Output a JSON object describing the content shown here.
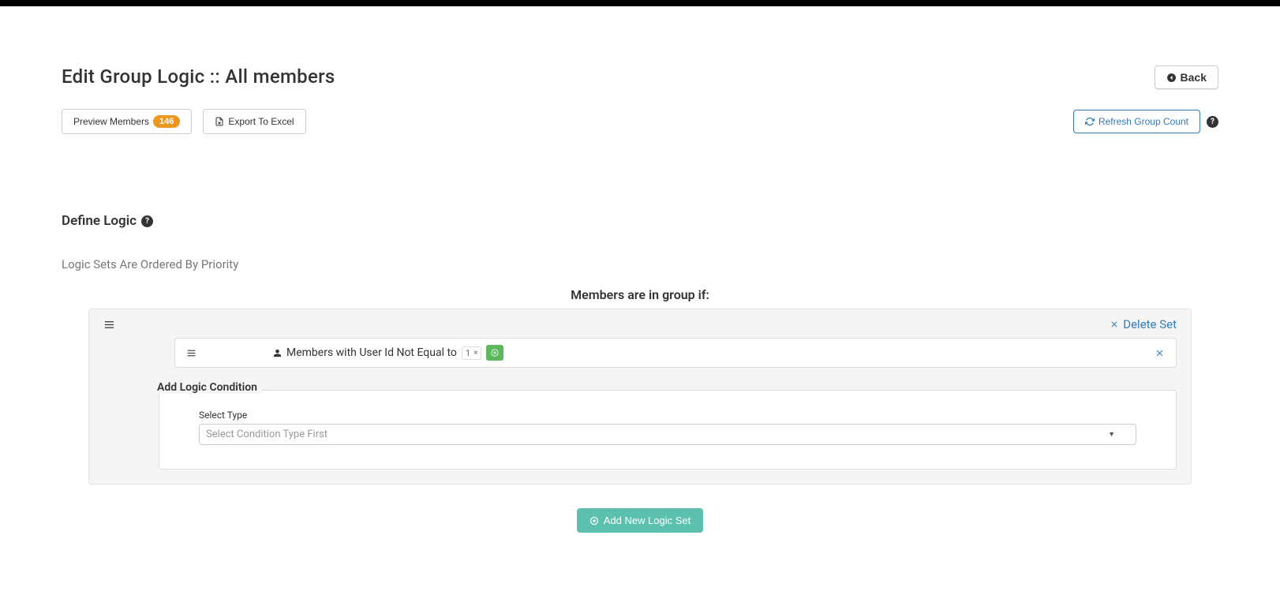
{
  "header": {
    "title": "Edit Group Logic :: All members",
    "back_label": "Back"
  },
  "actions": {
    "preview_label": "Preview Members",
    "preview_count": "146",
    "export_label": "Export To Excel",
    "refresh_label": "Refresh Group Count"
  },
  "define": {
    "title": "Define Logic",
    "priority_note": "Logic Sets Are Ordered By Priority",
    "group_heading": "Members are in group if:"
  },
  "logic_set": {
    "delete_label": "Delete Set",
    "condition_text": "Members with User Id Not Equal to",
    "tag_value": "1",
    "add_condition_legend": "Add Logic Condition",
    "select_type_label": "Select Type",
    "select_placeholder": "Select Condition Type First"
  },
  "footer": {
    "add_set_label": "Add New Logic Set"
  }
}
